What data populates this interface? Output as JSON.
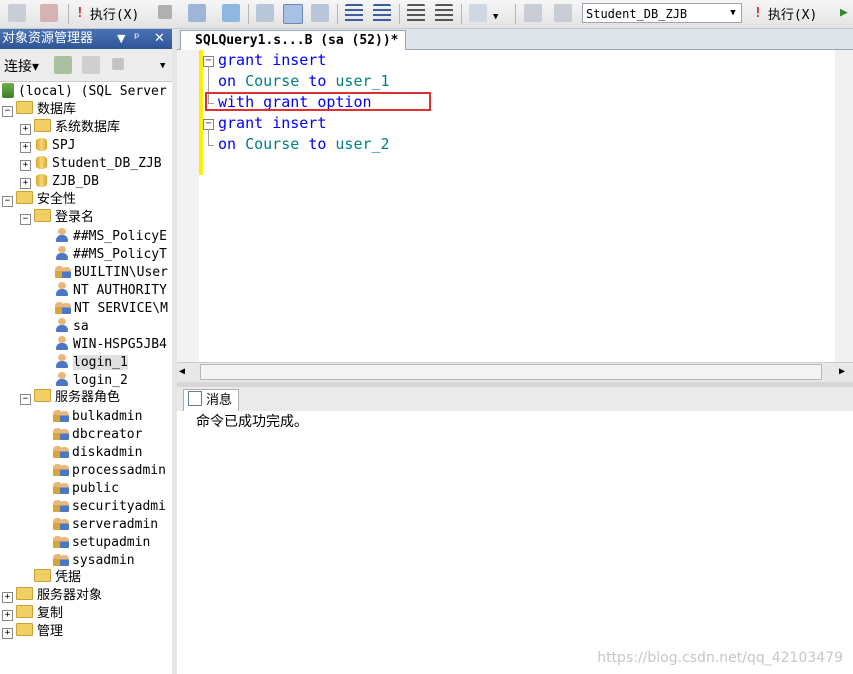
{
  "toolbar": {
    "execute_label": "执行(X)",
    "execute_label_right": "执行(X)",
    "database_select": "Student_DB_ZJB"
  },
  "object_explorer": {
    "title": "对象资源管理器",
    "pin_glyph": "▾ ᵖ ✕",
    "connect_label": "连接▾"
  },
  "tree": {
    "server": "(local) (SQL Server",
    "databases": "数据库",
    "system_db": "系统数据库",
    "db1": "SPJ",
    "db2": "Student_DB_ZJB",
    "db3": "ZJB_DB",
    "security": "安全性",
    "logins": "登录名",
    "login_items": [
      "##MS_PolicyE",
      "##MS_PolicyT",
      "BUILTIN\\User",
      "NT AUTHORITY",
      "NT SERVICE\\M",
      "sa",
      "WIN-HSPG5JB4",
      "login_1",
      "login_2"
    ],
    "server_roles": "服务器角色",
    "role_items": [
      "bulkadmin",
      "dbcreator",
      "diskadmin",
      "processadmin",
      "public",
      "securityadmi",
      "serveradmin",
      "setupadmin",
      "sysadmin"
    ],
    "credentials": "凭据",
    "server_objects": "服务器对象",
    "replication": "复制",
    "management": "管理"
  },
  "editor": {
    "tab_title": "SQLQuery1.s...B (sa (52))*",
    "lines": [
      {
        "kw1": "grant",
        "kw2": "insert"
      },
      {
        "kw1": "on",
        "id1": "Course",
        "kw2": "to",
        "id2": "user_1"
      },
      {
        "kw1": "with",
        "kw2": "grant",
        "kw3": "option"
      },
      {
        "kw1": "grant",
        "kw2": "insert"
      },
      {
        "kw1": "on",
        "id1": "Course",
        "kw2": "to",
        "id2": "user_2"
      }
    ]
  },
  "messages": {
    "tab_label": "消息",
    "text": "命令已成功完成。"
  },
  "watermark": "https://blog.csdn.net/qq_42103479",
  "colors": {
    "keyword": "#0000ff",
    "identifier": "#008080",
    "highlight_box": "#e03030",
    "change_bar": "#ffee00",
    "panel_title": "#2f5597"
  }
}
